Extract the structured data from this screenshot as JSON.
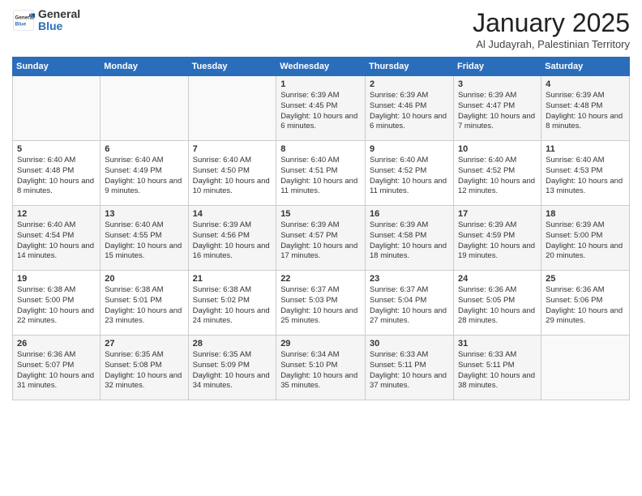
{
  "header": {
    "logo_general": "General",
    "logo_blue": "Blue",
    "title": "January 2025",
    "subtitle": "Al Judayrah, Palestinian Territory"
  },
  "days_of_week": [
    "Sunday",
    "Monday",
    "Tuesday",
    "Wednesday",
    "Thursday",
    "Friday",
    "Saturday"
  ],
  "weeks": [
    [
      {
        "num": "",
        "info": ""
      },
      {
        "num": "",
        "info": ""
      },
      {
        "num": "",
        "info": ""
      },
      {
        "num": "1",
        "info": "Sunrise: 6:39 AM\nSunset: 4:45 PM\nDaylight: 10 hours and 6 minutes."
      },
      {
        "num": "2",
        "info": "Sunrise: 6:39 AM\nSunset: 4:46 PM\nDaylight: 10 hours and 6 minutes."
      },
      {
        "num": "3",
        "info": "Sunrise: 6:39 AM\nSunset: 4:47 PM\nDaylight: 10 hours and 7 minutes."
      },
      {
        "num": "4",
        "info": "Sunrise: 6:39 AM\nSunset: 4:48 PM\nDaylight: 10 hours and 8 minutes."
      }
    ],
    [
      {
        "num": "5",
        "info": "Sunrise: 6:40 AM\nSunset: 4:48 PM\nDaylight: 10 hours and 8 minutes."
      },
      {
        "num": "6",
        "info": "Sunrise: 6:40 AM\nSunset: 4:49 PM\nDaylight: 10 hours and 9 minutes."
      },
      {
        "num": "7",
        "info": "Sunrise: 6:40 AM\nSunset: 4:50 PM\nDaylight: 10 hours and 10 minutes."
      },
      {
        "num": "8",
        "info": "Sunrise: 6:40 AM\nSunset: 4:51 PM\nDaylight: 10 hours and 11 minutes."
      },
      {
        "num": "9",
        "info": "Sunrise: 6:40 AM\nSunset: 4:52 PM\nDaylight: 10 hours and 11 minutes."
      },
      {
        "num": "10",
        "info": "Sunrise: 6:40 AM\nSunset: 4:52 PM\nDaylight: 10 hours and 12 minutes."
      },
      {
        "num": "11",
        "info": "Sunrise: 6:40 AM\nSunset: 4:53 PM\nDaylight: 10 hours and 13 minutes."
      }
    ],
    [
      {
        "num": "12",
        "info": "Sunrise: 6:40 AM\nSunset: 4:54 PM\nDaylight: 10 hours and 14 minutes."
      },
      {
        "num": "13",
        "info": "Sunrise: 6:40 AM\nSunset: 4:55 PM\nDaylight: 10 hours and 15 minutes."
      },
      {
        "num": "14",
        "info": "Sunrise: 6:39 AM\nSunset: 4:56 PM\nDaylight: 10 hours and 16 minutes."
      },
      {
        "num": "15",
        "info": "Sunrise: 6:39 AM\nSunset: 4:57 PM\nDaylight: 10 hours and 17 minutes."
      },
      {
        "num": "16",
        "info": "Sunrise: 6:39 AM\nSunset: 4:58 PM\nDaylight: 10 hours and 18 minutes."
      },
      {
        "num": "17",
        "info": "Sunrise: 6:39 AM\nSunset: 4:59 PM\nDaylight: 10 hours and 19 minutes."
      },
      {
        "num": "18",
        "info": "Sunrise: 6:39 AM\nSunset: 5:00 PM\nDaylight: 10 hours and 20 minutes."
      }
    ],
    [
      {
        "num": "19",
        "info": "Sunrise: 6:38 AM\nSunset: 5:00 PM\nDaylight: 10 hours and 22 minutes."
      },
      {
        "num": "20",
        "info": "Sunrise: 6:38 AM\nSunset: 5:01 PM\nDaylight: 10 hours and 23 minutes."
      },
      {
        "num": "21",
        "info": "Sunrise: 6:38 AM\nSunset: 5:02 PM\nDaylight: 10 hours and 24 minutes."
      },
      {
        "num": "22",
        "info": "Sunrise: 6:37 AM\nSunset: 5:03 PM\nDaylight: 10 hours and 25 minutes."
      },
      {
        "num": "23",
        "info": "Sunrise: 6:37 AM\nSunset: 5:04 PM\nDaylight: 10 hours and 27 minutes."
      },
      {
        "num": "24",
        "info": "Sunrise: 6:36 AM\nSunset: 5:05 PM\nDaylight: 10 hours and 28 minutes."
      },
      {
        "num": "25",
        "info": "Sunrise: 6:36 AM\nSunset: 5:06 PM\nDaylight: 10 hours and 29 minutes."
      }
    ],
    [
      {
        "num": "26",
        "info": "Sunrise: 6:36 AM\nSunset: 5:07 PM\nDaylight: 10 hours and 31 minutes."
      },
      {
        "num": "27",
        "info": "Sunrise: 6:35 AM\nSunset: 5:08 PM\nDaylight: 10 hours and 32 minutes."
      },
      {
        "num": "28",
        "info": "Sunrise: 6:35 AM\nSunset: 5:09 PM\nDaylight: 10 hours and 34 minutes."
      },
      {
        "num": "29",
        "info": "Sunrise: 6:34 AM\nSunset: 5:10 PM\nDaylight: 10 hours and 35 minutes."
      },
      {
        "num": "30",
        "info": "Sunrise: 6:33 AM\nSunset: 5:11 PM\nDaylight: 10 hours and 37 minutes."
      },
      {
        "num": "31",
        "info": "Sunrise: 6:33 AM\nSunset: 5:11 PM\nDaylight: 10 hours and 38 minutes."
      },
      {
        "num": "",
        "info": ""
      }
    ]
  ]
}
